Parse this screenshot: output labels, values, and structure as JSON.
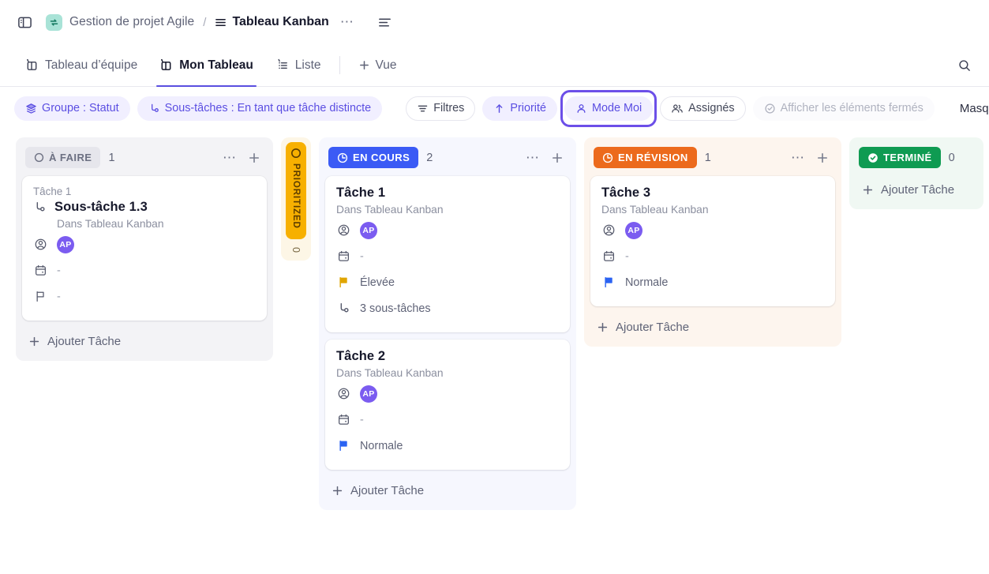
{
  "topbar": {
    "sidebar_toggle_icon": "sidebar-panel-icon",
    "project_icon": "sync-arrows-icon",
    "project_name": "Gestion de projet Agile",
    "separator": "/",
    "view_icon": "board-lines-icon",
    "view_name": "Tableau Kanban",
    "more_label": "⋯",
    "menu_icon": "list-lines-icon"
  },
  "tabs": {
    "items": [
      {
        "label": "Tableau d’équipe",
        "icon": "board-pin-icon",
        "active": false
      },
      {
        "label": "Mon Tableau",
        "icon": "board-pin-icon",
        "active": true
      },
      {
        "label": "Liste",
        "icon": "list-pin-icon",
        "active": false
      }
    ],
    "add_view_label": "Vue",
    "add_view_icon": "plus-icon",
    "search_icon": "search-icon"
  },
  "filters": {
    "group_label": "Groupe : Statut",
    "group_icon": "layers-icon",
    "subtasks_label": "Sous-tâches : En tant que tâche distincte",
    "subtasks_icon": "subtask-icon",
    "filters_label": "Filtres",
    "filters_icon": "filter-icon",
    "priority_label": "Priorité",
    "priority_icon": "arrow-up-icon",
    "me_mode_label": "Mode Moi",
    "me_mode_icon": "person-icon",
    "assignees_label": "Assignés",
    "assignees_icon": "people-icon",
    "show_closed_label": "Afficher les éléments fermés",
    "show_closed_icon": "check-circle-icon",
    "hide_label": "Masquer"
  },
  "board": {
    "add_task_label": "Ajouter Tâche",
    "add_task_icon": "plus-icon",
    "column_more_icon": "⋯",
    "column_add_icon": "+",
    "collapsed": {
      "label": "PRIORITIZED",
      "count": "0",
      "status_icon": "circle-icon"
    },
    "columns": [
      {
        "key": "todo",
        "status": "À FAIRE",
        "status_icon": "circle-icon",
        "count": "1",
        "cards": [
          {
            "parent": "Tâche 1",
            "title": "Sous-tâche 1.3",
            "title_icon": "subtask-icon",
            "location": "Dans Tableau Kanban",
            "assignee_icon": "assignee-icon",
            "assignee_initials": "AP",
            "date_icon": "calendar-icon",
            "date_value": "-",
            "priority_icon": "flag-outline-icon",
            "priority_value": "-",
            "priority_color": "#9a9eae"
          }
        ]
      },
      {
        "key": "prog",
        "status": "EN COURS",
        "status_icon": "clock-icon",
        "count": "2",
        "cards": [
          {
            "title": "Tâche 1",
            "location": "Dans Tableau Kanban",
            "assignee_icon": "assignee-icon",
            "assignee_initials": "AP",
            "date_icon": "calendar-icon",
            "date_value": "-",
            "priority_icon": "flag-filled-icon",
            "priority_value": "Élevée",
            "priority_color": "#e0a500",
            "subtasks_icon": "subtask-icon",
            "subtasks_value": "3 sous-tâches"
          },
          {
            "title": "Tâche 2",
            "location": "Dans Tableau Kanban",
            "assignee_icon": "assignee-icon",
            "assignee_initials": "AP",
            "date_icon": "calendar-icon",
            "date_value": "-",
            "priority_icon": "flag-filled-icon",
            "priority_value": "Normale",
            "priority_color": "#2b63f2"
          }
        ]
      },
      {
        "key": "rev",
        "status": "EN RÉVISION",
        "status_icon": "clock-icon",
        "count": "1",
        "cards": [
          {
            "title": "Tâche 3",
            "location": "Dans Tableau Kanban",
            "assignee_icon": "assignee-icon",
            "assignee_initials": "AP",
            "date_icon": "calendar-icon",
            "date_value": "-",
            "priority_icon": "flag-filled-icon",
            "priority_value": "Normale",
            "priority_color": "#2b63f2"
          }
        ]
      },
      {
        "key": "done",
        "status": "TERMINÉ",
        "status_icon": "check-circle-filled-icon",
        "count": "0",
        "cards": []
      }
    ]
  },
  "colors": {
    "accent_purple": "#5b4ee2",
    "status_todo": "#e6e6ec",
    "status_progress": "#3b5bf5",
    "status_review": "#ec6a1c",
    "status_done": "#0f9b52",
    "prioritized_amber": "#f7b000",
    "avatar": "#7b5cf0"
  }
}
